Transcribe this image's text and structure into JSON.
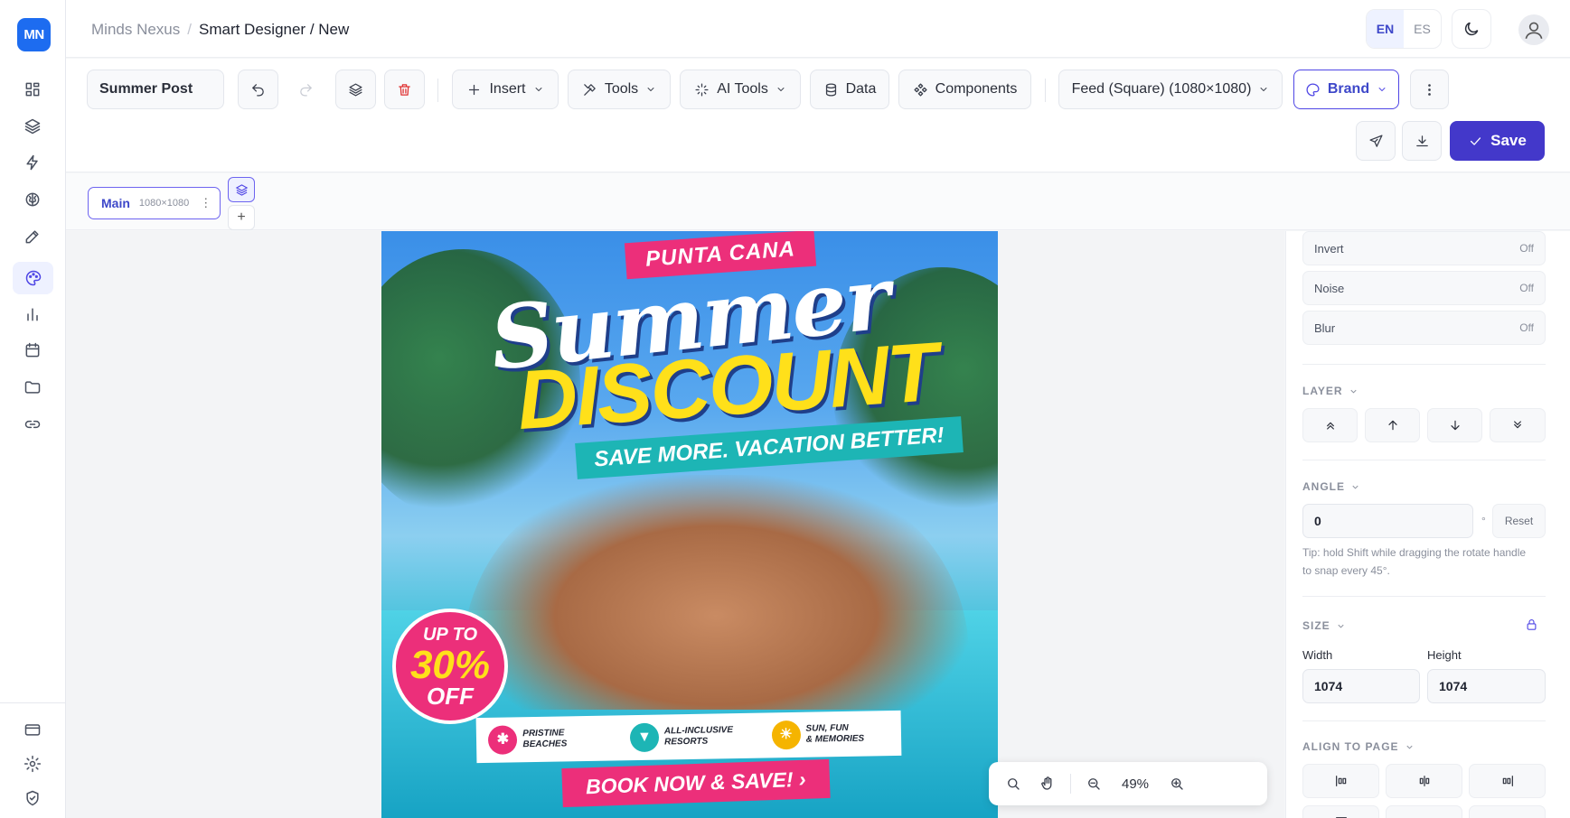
{
  "app": {
    "logo": "MN",
    "breadcrumb": {
      "parent": "Minds Nexus",
      "current": "Smart Designer / New"
    },
    "lang": {
      "en": "EN",
      "es": "ES"
    },
    "sidebar_icons": [
      "dashboard-icon",
      "layers-icon",
      "bolt-icon",
      "brain-icon",
      "pen-icon",
      "palette-icon",
      "chart-icon",
      "calendar-icon",
      "folder-icon",
      "link-icon",
      "card-icon",
      "gear-icon",
      "shield-icon"
    ]
  },
  "toolbar": {
    "design_name": "Summer Post",
    "insert": "Insert",
    "tools": "Tools",
    "ai_tools": "AI Tools",
    "data": "Data",
    "components": "Components",
    "format": "Feed (Square) (1080×1080)",
    "brand": "Brand",
    "save": "Save"
  },
  "pages": {
    "main_label": "Main",
    "main_size": "1080×1080",
    "add": "+"
  },
  "poster": {
    "tag": "PUNTA CANA",
    "headline1": "Summer",
    "headline2": "DISCOUNT",
    "tagline": "SAVE MORE. VACATION BETTER!",
    "badge_top": "UP TO",
    "badge_value": "30%",
    "badge_bottom": "OFF",
    "features": [
      {
        "line1": "PRISTINE",
        "line2": "BEACHES",
        "color": "#ec2f7a"
      },
      {
        "line1": "ALL-INCLUSIVE",
        "line2": "RESORTS",
        "color": "#1db5b5"
      },
      {
        "line1": "SUN, FUN",
        "line2": "& MEMORIES",
        "color": "#f5b400"
      }
    ],
    "cta": "BOOK NOW & SAVE!"
  },
  "zoom": {
    "value": "49%"
  },
  "panel": {
    "effects": [
      {
        "label": "Invert",
        "value": "Off"
      },
      {
        "label": "Noise",
        "value": "Off"
      },
      {
        "label": "Blur",
        "value": "Off"
      }
    ],
    "layer_title": "LAYER",
    "angle_title": "ANGLE",
    "angle_value": "0",
    "angle_unit": "°",
    "reset": "Reset",
    "tip": "Tip: hold Shift while dragging the rotate handle to snap every 45°.",
    "size_title": "SIZE",
    "width_label": "Width",
    "height_label": "Height",
    "width_value": "1074",
    "height_value": "1074",
    "align_title": "ALIGN TO PAGE"
  }
}
